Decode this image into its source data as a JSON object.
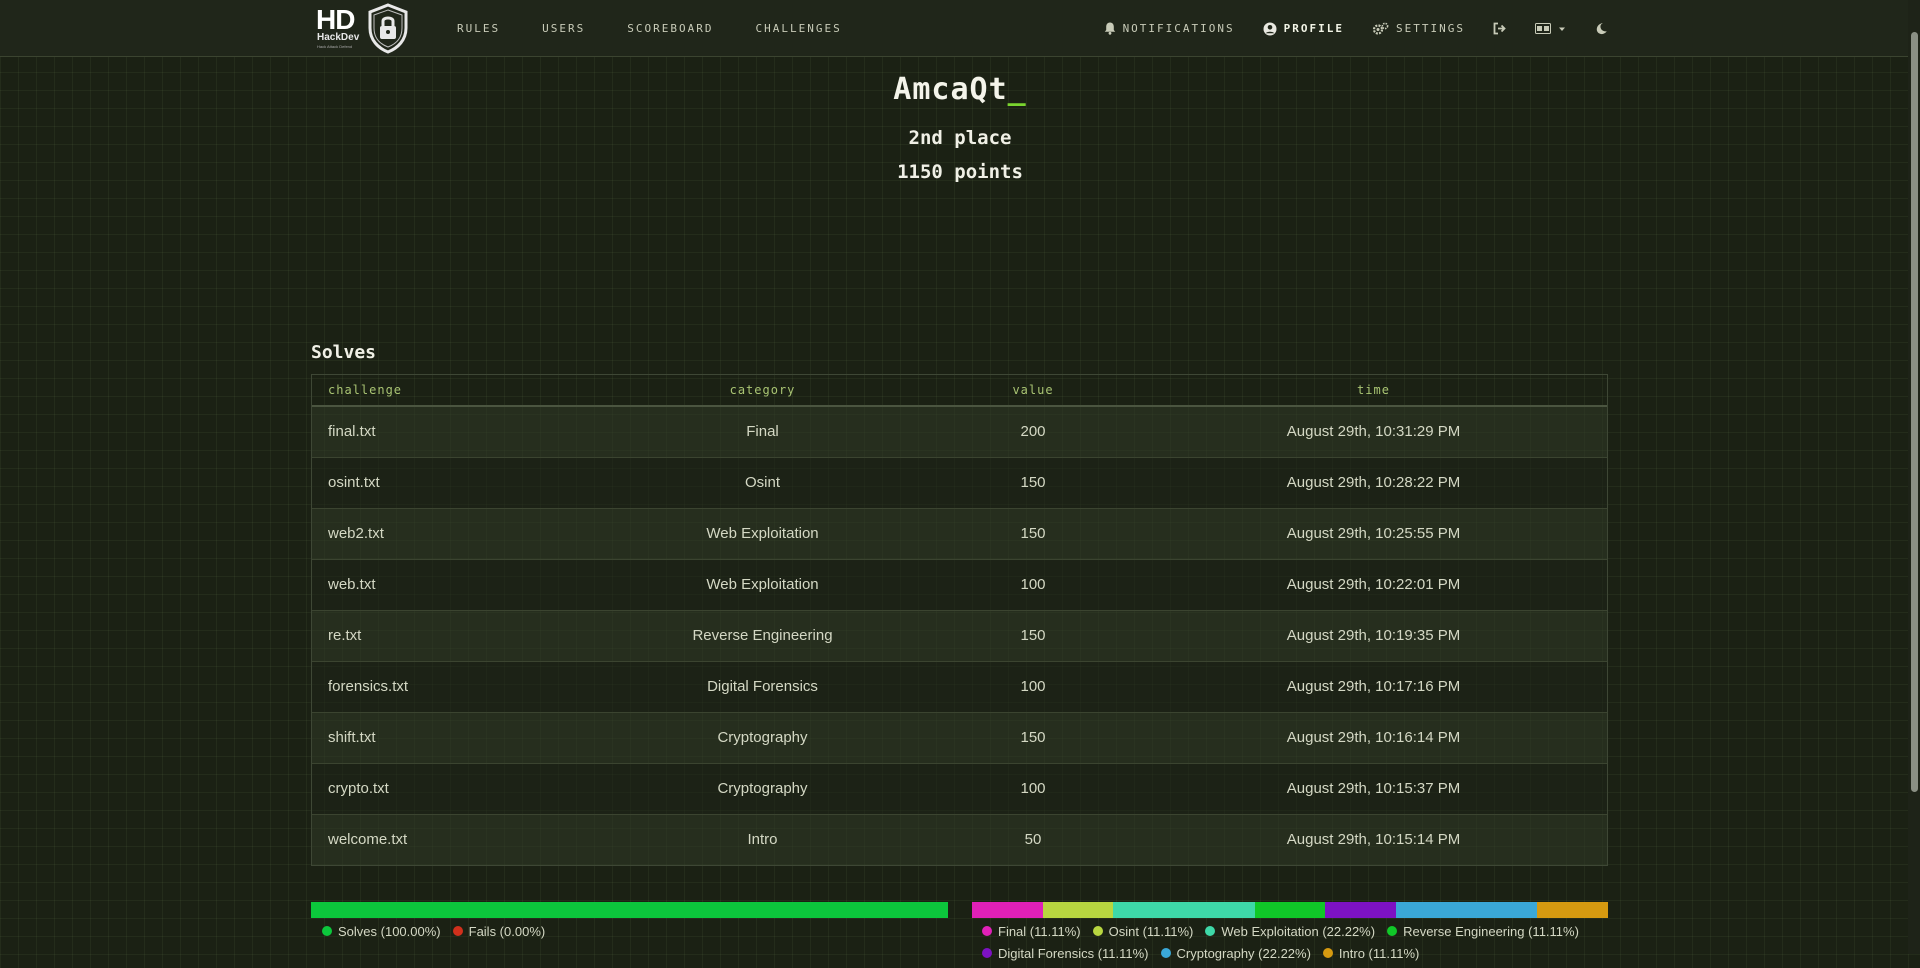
{
  "brand": {
    "hd": "HD",
    "name": "HackDev",
    "tagline": "Hack Attack Defend"
  },
  "nav": {
    "links": [
      "Rules",
      "Users",
      "Scoreboard",
      "Challenges"
    ],
    "notifications": "Notifications",
    "profile": "Profile",
    "settings": "Settings"
  },
  "profile": {
    "username": "AmcaQt",
    "cursor": "_",
    "place": "2nd place",
    "points": "1150 points"
  },
  "solves": {
    "title": "Solves",
    "columns": [
      "challenge",
      "category",
      "value",
      "time"
    ],
    "rows": [
      {
        "challenge": "final.txt",
        "category": "Final",
        "value": "200",
        "time": "August 29th, 10:31:29 PM"
      },
      {
        "challenge": "osint.txt",
        "category": "Osint",
        "value": "150",
        "time": "August 29th, 10:28:22 PM"
      },
      {
        "challenge": "web2.txt",
        "category": "Web Exploitation",
        "value": "150",
        "time": "August 29th, 10:25:55 PM"
      },
      {
        "challenge": "web.txt",
        "category": "Web Exploitation",
        "value": "100",
        "time": "August 29th, 10:22:01 PM"
      },
      {
        "challenge": "re.txt",
        "category": "Reverse Engineering",
        "value": "150",
        "time": "August 29th, 10:19:35 PM"
      },
      {
        "challenge": "forensics.txt",
        "category": "Digital Forensics",
        "value": "100",
        "time": "August 29th, 10:17:16 PM"
      },
      {
        "challenge": "shift.txt",
        "category": "Cryptography",
        "value": "150",
        "time": "August 29th, 10:16:14 PM"
      },
      {
        "challenge": "crypto.txt",
        "category": "Cryptography",
        "value": "100",
        "time": "August 29th, 10:15:37 PM"
      },
      {
        "challenge": "welcome.txt",
        "category": "Intro",
        "value": "50",
        "time": "August 29th, 10:15:14 PM"
      }
    ]
  },
  "solve_ratio": {
    "segments": [
      {
        "label": "Solves (100.00%)",
        "percent": 100,
        "color": "#0cc73c"
      },
      {
        "label": "Fails (0.00%)",
        "percent": 0,
        "color": "#d0301c"
      }
    ]
  },
  "category_breakdown": {
    "segments": [
      {
        "label": "Final (11.11%)",
        "percent": 11.11,
        "color": "#e020b8"
      },
      {
        "label": "Osint (11.11%)",
        "percent": 11.11,
        "color": "#b8d640"
      },
      {
        "label": "Web Exploitation (22.22%)",
        "percent": 22.22,
        "color": "#3ed8a8"
      },
      {
        "label": "Reverse Engineering (11.11%)",
        "percent": 11.11,
        "color": "#10c828"
      },
      {
        "label": "Digital Forensics (11.11%)",
        "percent": 11.11,
        "color": "#7d12c4"
      },
      {
        "label": "Cryptography (22.22%)",
        "percent": 22.22,
        "color": "#3aa8d8"
      },
      {
        "label": "Intro (11.11%)",
        "percent": 11.11,
        "color": "#d69a10"
      }
    ]
  },
  "colors": {
    "background": "#1b2114",
    "accent": "#7ad42f",
    "header": "#a9c473"
  }
}
